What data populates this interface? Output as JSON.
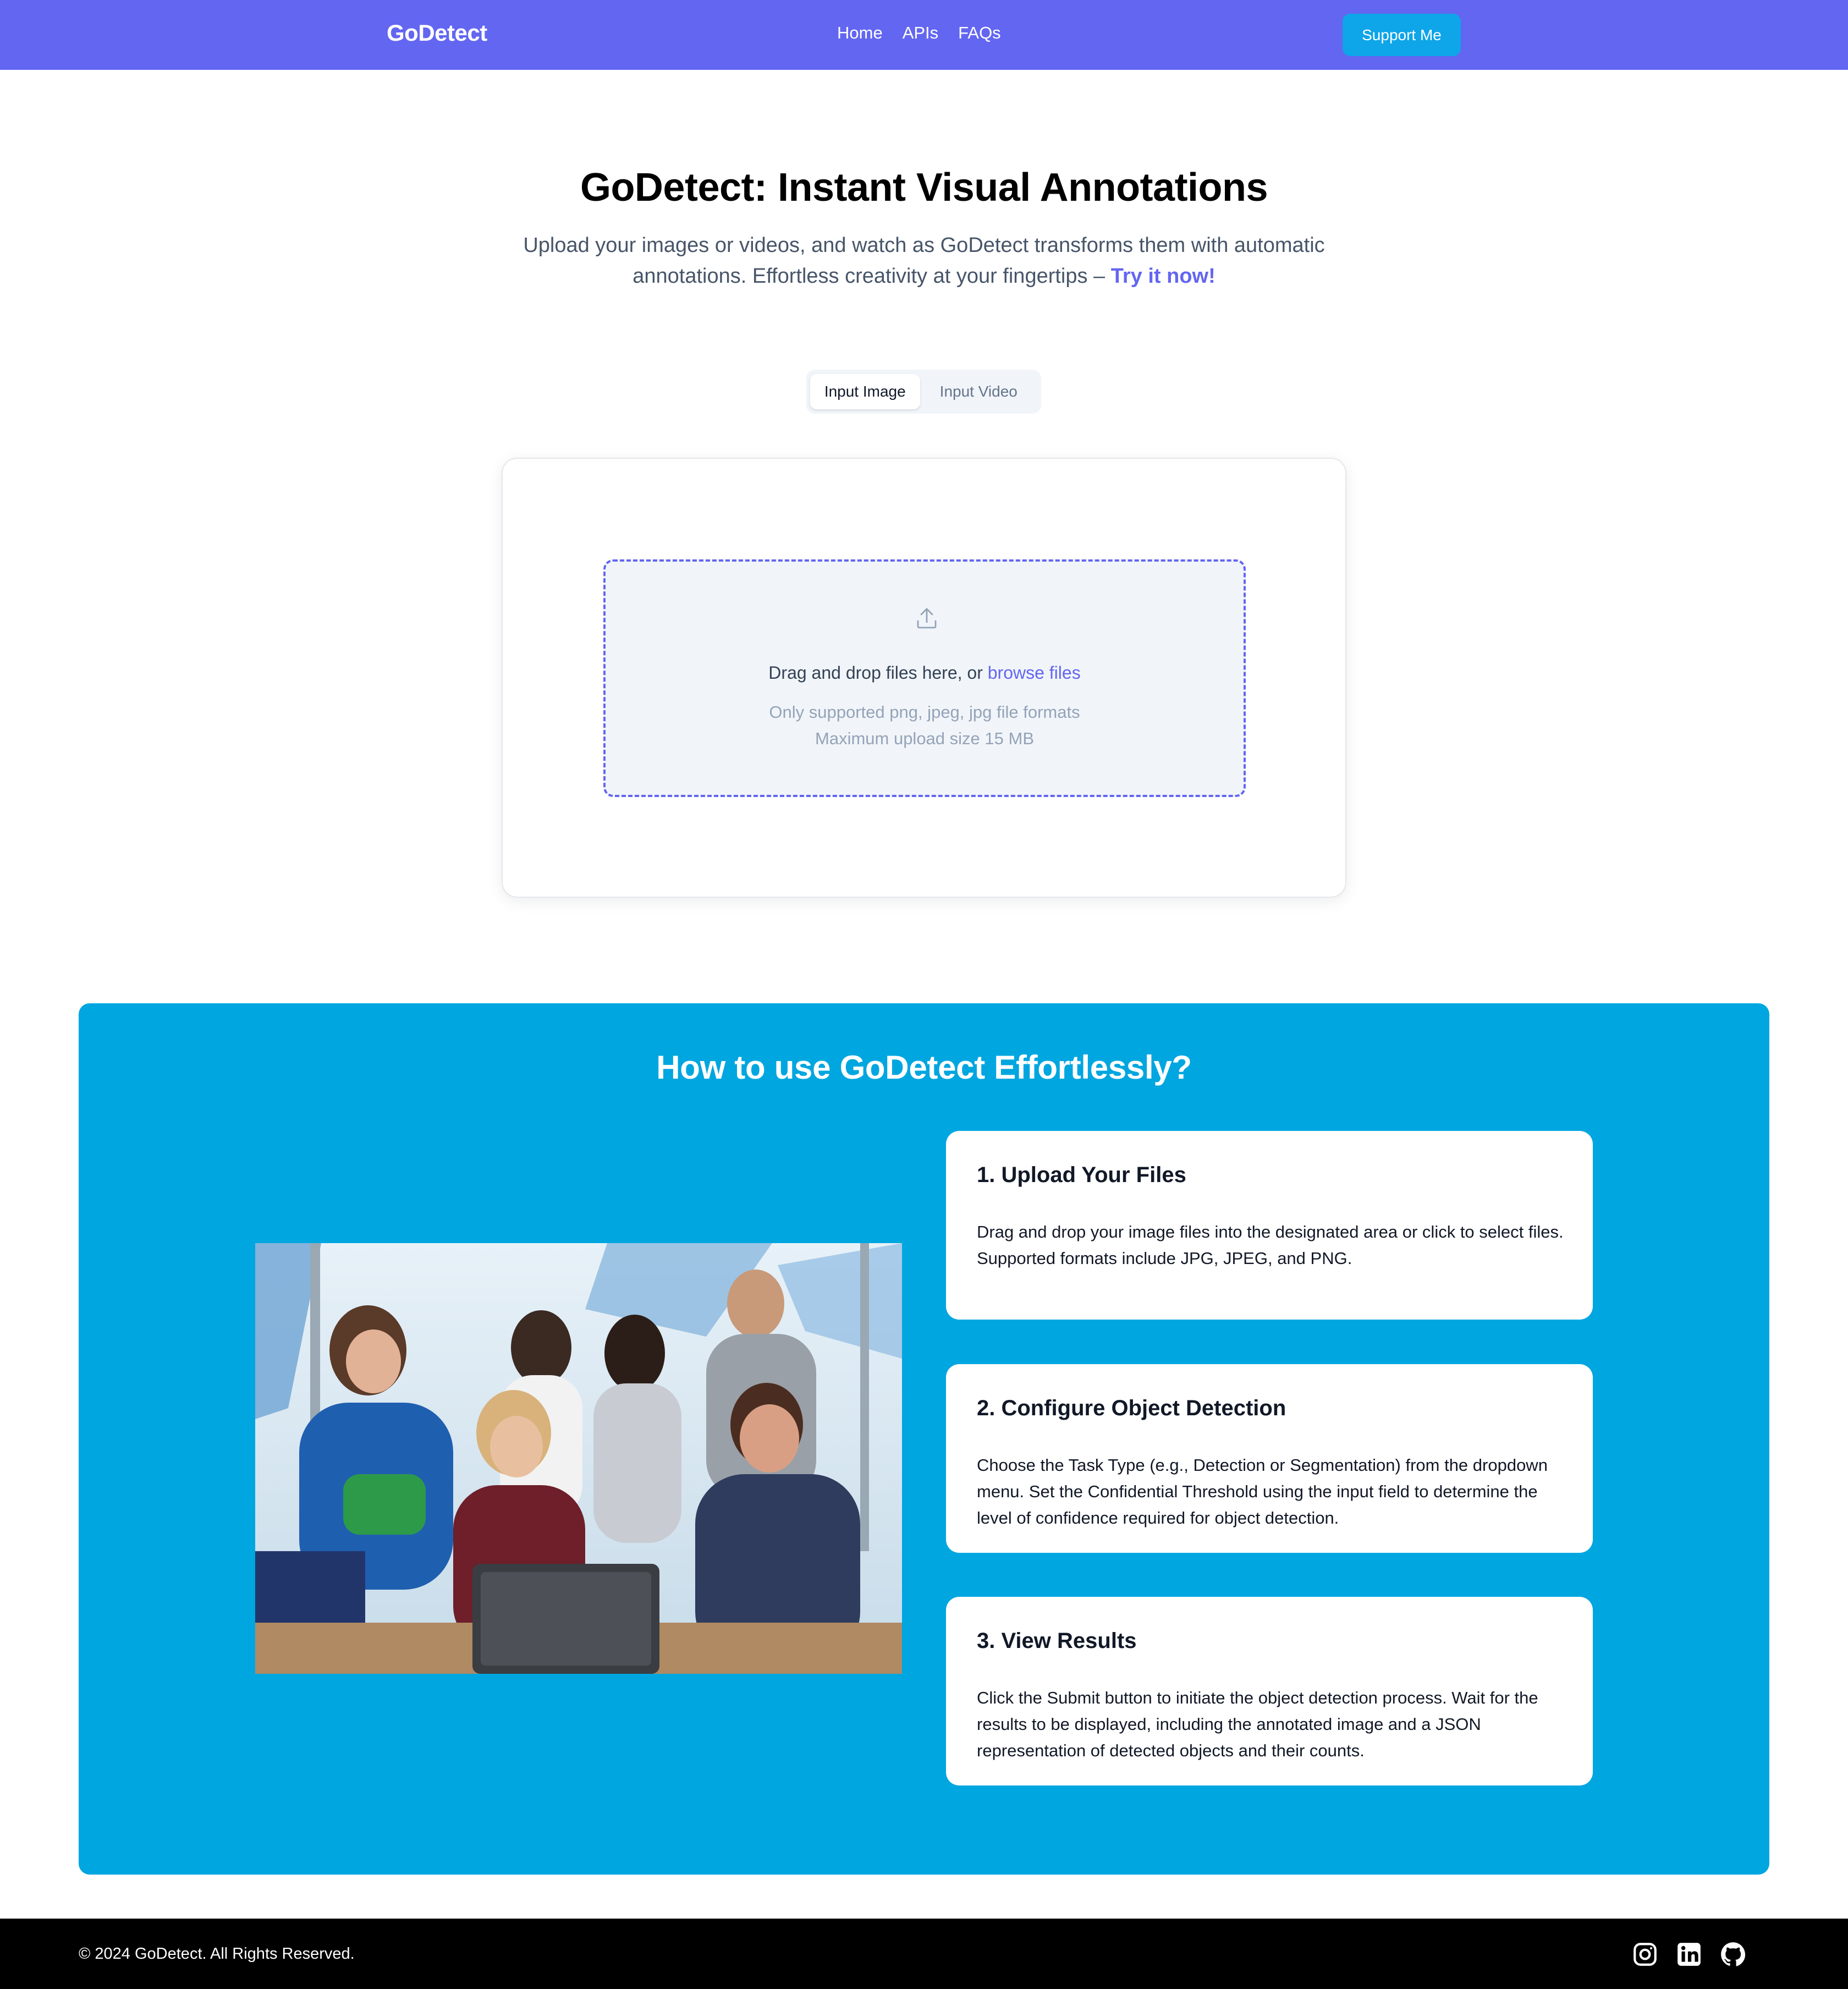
{
  "navbar": {
    "brand": "GoDetect",
    "links": [
      "Home",
      "APIs",
      "FAQs"
    ],
    "support_label": "Support Me"
  },
  "hero": {
    "title": "GoDetect: Instant Visual Annotations",
    "subtitle_line1": "Upload your images or videos, and watch as GoDetect transforms them with automatic",
    "subtitle_line2": "annotations. Effortless creativity at your fingertips –",
    "cta": "Try it now!"
  },
  "tabs": {
    "image": "Input Image",
    "video": "Input Video",
    "active": "Input Image"
  },
  "upload": {
    "drop_text": "Drag and drop files here, or",
    "browse_link": "browse files",
    "formats": "Only supported png, jpeg, jpg file formats",
    "max_size": "Maximum upload size 15 MB"
  },
  "howto": {
    "title": "How to use GoDetect Effortlessly?",
    "steps": [
      {
        "title": "1. Upload Your Files",
        "text": "Drag and drop your image files into the designated area or click to select files. Supported formats include JPG, JPEG, and PNG."
      },
      {
        "title": "2. Configure Object Detection",
        "text": "Choose the Task Type (e.g., Detection or Segmentation) from the dropdown menu. Set the Confidential Threshold using the input field to determine the level of confidence required for object detection."
      },
      {
        "title": "3. View Results",
        "text": "Click the Submit button to initiate the object detection process. Wait for the results to be displayed, including the annotated image and a JSON representation of detected objects and their counts."
      }
    ]
  },
  "footer": {
    "copyright": "© 2024 GoDetect. All Rights Reserved.",
    "social_icons": [
      "instagram-icon",
      "linkedin-icon",
      "github-icon"
    ]
  },
  "colors": {
    "nav_bg": "#6366f1",
    "accent": "#6366f1",
    "support_button": "#0ea5e9",
    "howto_bg": "#00a6e0",
    "footer_bg": "#000000"
  }
}
